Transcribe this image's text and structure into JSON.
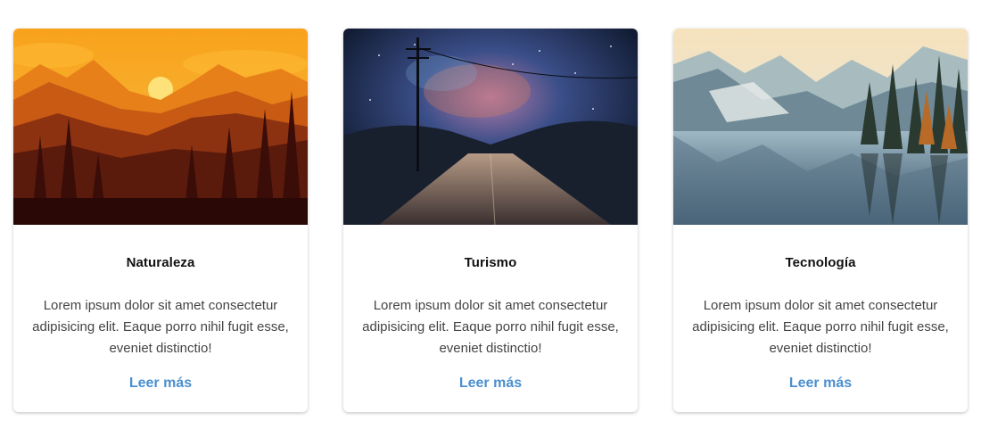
{
  "accent_color": "#4a8fcf",
  "cards": [
    {
      "image": "forest-sunset-mountains-illustration",
      "title": "Naturaleza",
      "text": "Lorem ipsum dolor sit amet consectetur adipisicing elit. Eaque porro nihil fugit esse, eveniet distinctio!",
      "link": "Leer más"
    },
    {
      "image": "night-road-galaxy-sky-photo",
      "title": "Turismo",
      "text": "Lorem ipsum dolor sit amet consectetur adipisicing elit. Eaque porro nihil fugit esse, eveniet distinctio!",
      "link": "Leer más"
    },
    {
      "image": "mountain-lake-reflection-photo",
      "title": "Tecnología",
      "text": "Lorem ipsum dolor sit amet consectetur adipisicing elit. Eaque porro nihil fugit esse, eveniet distinctio!",
      "link": "Leer más"
    }
  ]
}
